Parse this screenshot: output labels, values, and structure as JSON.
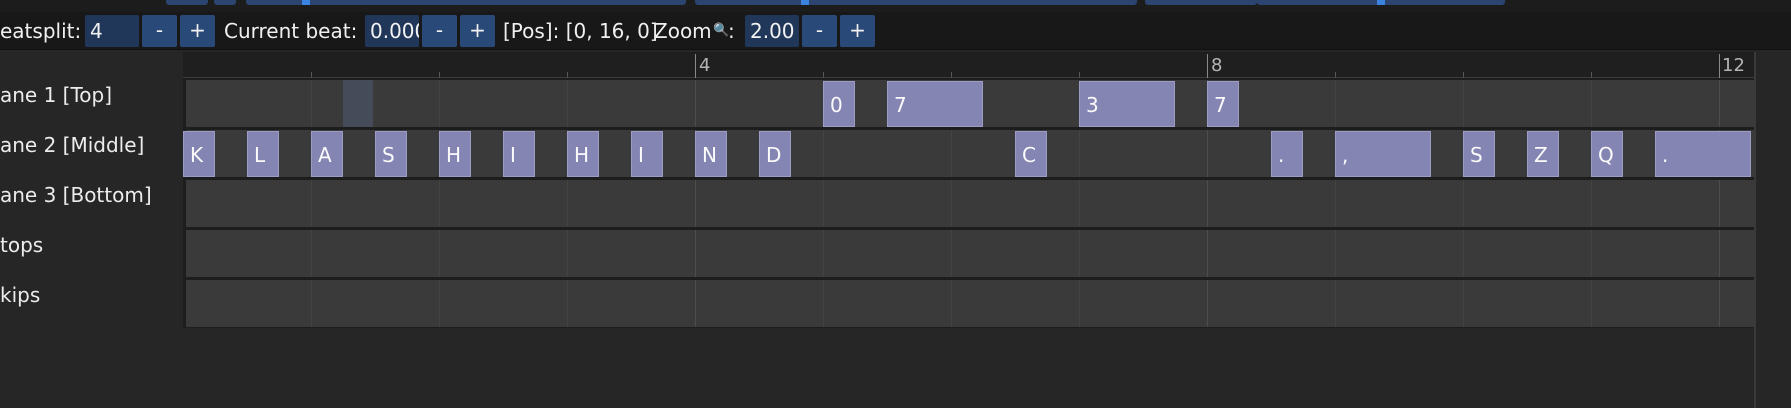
{
  "toolbar": {
    "beatsplit_label": "eatsplit:",
    "beatsplit_value": "4",
    "minus": "-",
    "plus": "+",
    "current_beat_label": "Current beat:",
    "current_beat_value": "0.000",
    "pos_label": "[Pos]: [0, 16, 0]",
    "zoom_label": "Zoom",
    "zoom_icon_glyph": "🔍",
    "zoom_colon": ":",
    "zoom_value": "2.00"
  },
  "ruler": {
    "markers": [
      "4",
      "8",
      "12"
    ]
  },
  "lanes": [
    {
      "label": "ane 1 [Top]"
    },
    {
      "label": "ane 2 [Middle]"
    },
    {
      "label": "ane 3 [Bottom]"
    },
    {
      "label": "tops"
    },
    {
      "label": "kips"
    }
  ],
  "notes": {
    "lane1": [
      "0",
      "7",
      "3",
      "7"
    ],
    "lane2": [
      "K",
      "L",
      "A",
      "S",
      "H",
      "I",
      "H",
      "I",
      "N",
      "D",
      "C",
      ".",
      ",",
      "S",
      "Z",
      "Q",
      "."
    ]
  },
  "colors": {
    "note": "#8585b4",
    "field": "#21375a",
    "button": "#294a78",
    "lane": "#3a3a3a"
  }
}
